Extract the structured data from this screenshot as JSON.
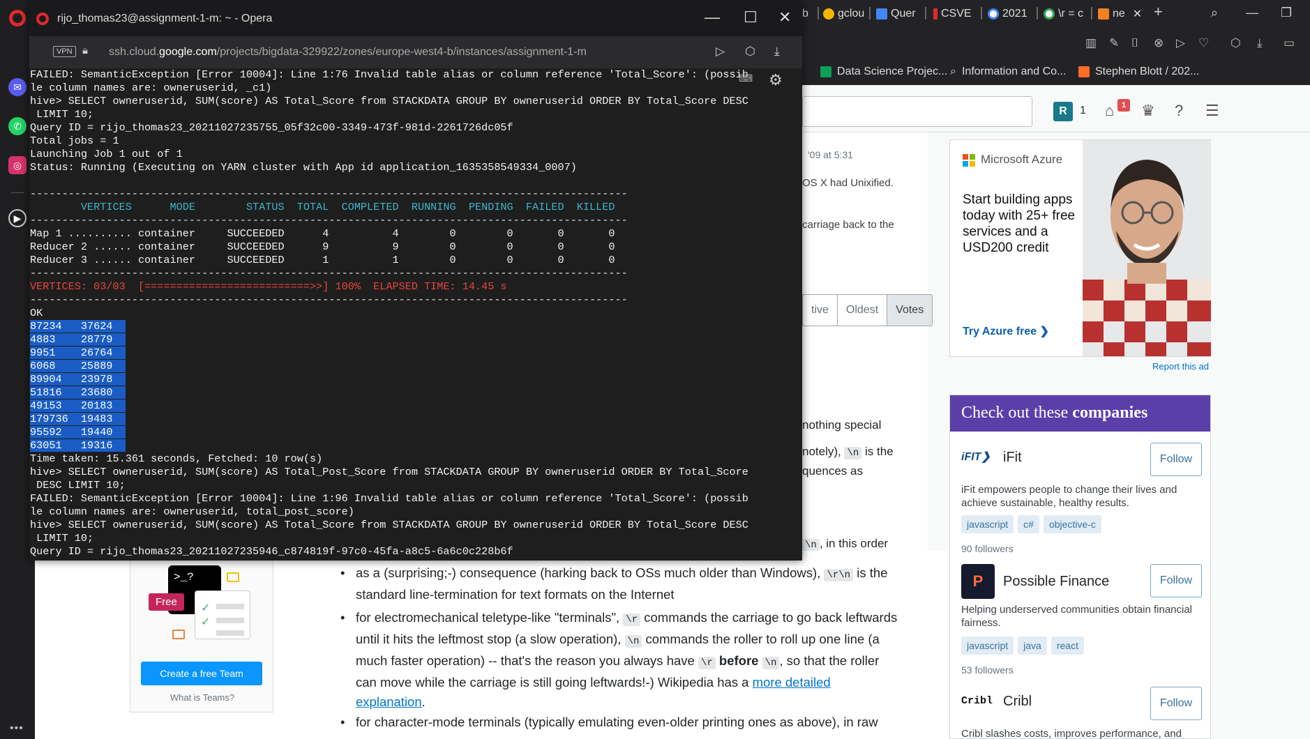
{
  "opera_sidebar": {
    "icons": [
      "opera-logo",
      "messenger-icon",
      "whatsapp-icon",
      "instagram-icon",
      "player-icon"
    ],
    "more": "•••"
  },
  "background_browser": {
    "tabs": [
      {
        "label": "b",
        "icon": "tab-icon"
      },
      {
        "label": "gclou",
        "icon": "google-cloud-icon"
      },
      {
        "label": "Quer",
        "icon": "doc-icon"
      },
      {
        "label": "CSVE",
        "icon": "pen-icon"
      },
      {
        "label": "2021",
        "icon": "google-icon"
      },
      {
        "label": "\\r = c",
        "icon": "google-icon"
      },
      {
        "label": "ne",
        "icon": "stackoverflow-icon"
      }
    ],
    "tab_close": "✕",
    "new_tab": "+",
    "bookmarks": [
      {
        "label": "Data Science Projec...",
        "icon": "google-drive-icon"
      },
      {
        "label": "Information and Co...",
        "icon": "search-icon"
      },
      {
        "label": "Stephen Blott / 202...",
        "icon": "gitlab-icon"
      }
    ],
    "so_header": {
      "avatar_letter": "R",
      "reputation": "1",
      "inbox_badge": "1"
    },
    "content": {
      "date_fragment": "'09 at 5:31",
      "line1": "OS X had Unixified.",
      "line2": "carriage back to the",
      "sort_tabs": [
        "tive",
        "Oldest",
        "Votes"
      ],
      "nothing_special": "nothing special",
      "motely_prefix": "notely),",
      "motely_code": "\\n",
      "motely_suffix": "is the",
      "sequences": "quences as",
      "order_code": "\\n",
      "order_suffix": ", in this order"
    },
    "ad": {
      "brand": "Microsoft Azure",
      "headline": "Start building apps today with 25+ free services and a USD200 credit",
      "cta": "Try Azure free ❯",
      "report": "Report this ad"
    },
    "companies": {
      "title_prefix": "Check out these ",
      "title_bold": "companies",
      "items": [
        {
          "logo": "iFIT❯",
          "name": "iFit",
          "follow": "Follow",
          "desc": "iFit empowers people to change their lives and achieve sustainable, healthy results.",
          "tags": [
            "javascript",
            "c#",
            "objective-c"
          ],
          "followers": "90 followers"
        },
        {
          "logo": "P",
          "name": "Possible Finance",
          "follow": "Follow",
          "desc": "Helping underserved communities obtain financial fairness.",
          "tags": [
            "javascript",
            "java",
            "react"
          ],
          "followers": "53 followers"
        },
        {
          "logo": "Cribl",
          "name": "Cribl",
          "follow": "Follow",
          "desc": "Cribl slashes costs, improves performance, and"
        }
      ]
    },
    "teams": {
      "free_badge": "Free",
      "terminal_glyph": ">_?",
      "create_button": "Create a free Team",
      "what_link": "What is Teams?"
    },
    "bullets": [
      {
        "pre": "as a (surprising;-) consequence (harking back to OSs much older than Windows),",
        "code": "\\r\\n",
        "post": "is the standard line-termination for text formats on the Internet"
      },
      {
        "pre": "for electromechanical teletype-like \"terminals\",",
        "code1": "\\r",
        "mid1": "commands the carriage to go back leftwards until it hits the leftmost stop (a slow operation),",
        "code2": "\\n",
        "mid2": "commands the roller to roll up one line (a much faster operation) -- that's the reason you always have",
        "code3": "\\r",
        "bold": "before",
        "code4": "\\n",
        "mid3": ", so that the roller can move while the carriage is still going leftwards!-) Wikipedia has a",
        "link": "more detailed explanation",
        "end": "."
      },
      {
        "pre": "for character-mode terminals (typically emulating even-older printing ones as above), in raw"
      }
    ]
  },
  "ssh_window": {
    "title": "rijo_thomas23@assignment-1-m: ~ - Opera",
    "controls": [
      "—",
      "☐",
      "✕"
    ],
    "vpn": "VPN",
    "url_prefix": "ssh.cloud.",
    "url_domain": "google.com",
    "url_path": "/projects/bigdata-329922/zones/europe-west4-b/instances/assignment-1-m",
    "terminal_lines": [
      {
        "t": "FAILED: SemanticException [Error 10004]: Line 1:76 Invalid table alias or column reference 'Total_Score': (possib"
      },
      {
        "t": "le column names are: owneruserid, _c1)"
      },
      {
        "t": "hive> SELECT owneruserid, SUM(score) AS Total_Score from STACKDATA GROUP BY owneruserid ORDER BY Total_Score DESC"
      },
      {
        "t": " LIMIT 10;"
      },
      {
        "t": "Query ID = rijo_thomas23_20211027235755_05f32c00-3349-473f-981d-2261726dc05f"
      },
      {
        "t": "Total jobs = 1"
      },
      {
        "t": "Launching Job 1 out of 1"
      },
      {
        "t": "Status: Running (Executing on YARN cluster with App id application_1635358549334_0007)"
      },
      {
        "t": ""
      },
      {
        "t": "----------------------------------------------------------------------------------------------",
        "c": "t-sep"
      },
      {
        "t": "        VERTICES      MODE        STATUS  TOTAL  COMPLETED  RUNNING  PENDING  FAILED  KILLED",
        "c": "t-hdr"
      },
      {
        "t": "----------------------------------------------------------------------------------------------",
        "c": "t-sep"
      },
      {
        "t": "Map 1 .......... container     SUCCEEDED      4          4        0        0       0       0"
      },
      {
        "t": "Reducer 2 ...... container     SUCCEEDED      9          9        0        0       0       0"
      },
      {
        "t": "Reducer 3 ...... container     SUCCEEDED      1          1        0        0       0       0"
      },
      {
        "t": "----------------------------------------------------------------------------------------------",
        "c": "t-sep"
      },
      {
        "t": "VERTICES: 03/03  [==========================>>] 100%  ELAPSED TIME: 14.45 s",
        "c": "t-red"
      },
      {
        "t": "----------------------------------------------------------------------------------------------",
        "c": "t-sep"
      },
      {
        "t": "OK"
      },
      {
        "t": "87234   37624",
        "sel": true,
        "lead": "8"
      },
      {
        "t": "4883    28779",
        "sel": true
      },
      {
        "t": "9951    26764",
        "sel": true
      },
      {
        "t": "6068    25889",
        "sel": true
      },
      {
        "t": "89904   23978",
        "sel": true
      },
      {
        "t": "51816   23680",
        "sel": true
      },
      {
        "t": "49153   20183",
        "sel": true
      },
      {
        "t": "179736  19483",
        "sel": true
      },
      {
        "t": "95592   19440",
        "sel": true
      },
      {
        "t": "63051   19316",
        "sel": true
      },
      {
        "t": "Time taken: 15.361 seconds, Fetched: 10 row(s)"
      },
      {
        "t": "hive> SELECT owneruserid, SUM(score) AS Total_Post_Score from STACKDATA GROUP BY owneruserid ORDER BY Total_Score"
      },
      {
        "t": " DESC LIMIT 10;"
      },
      {
        "t": "FAILED: SemanticException [Error 10004]: Line 1:96 Invalid table alias or column reference 'Total_Score': (possib"
      },
      {
        "t": "le column names are: owneruserid, total_post_score)"
      },
      {
        "t": "hive> SELECT owneruserid, SUM(score) AS Total_Score from STACKDATA GROUP BY owneruserid ORDER BY Total_Score DESC"
      },
      {
        "t": " LIMIT 10;"
      },
      {
        "t": "Query ID = rijo_thomas23_20211027235946_c874819f-97c0-45fa-a8c5-6a6c0c228b6f"
      }
    ]
  }
}
